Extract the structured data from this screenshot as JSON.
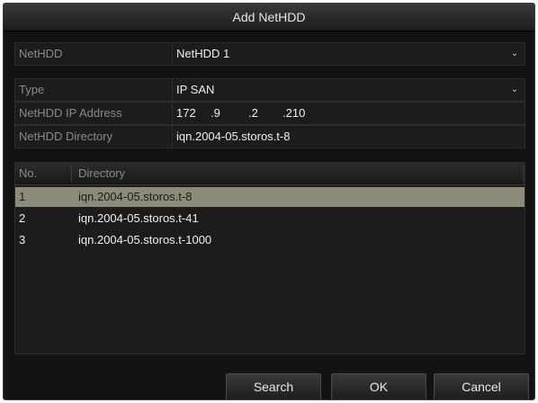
{
  "dialog": {
    "title": "Add NetHDD"
  },
  "form": {
    "nethdd": {
      "label": "NetHDD",
      "value": "NetHDD 1"
    },
    "type": {
      "label": "Type",
      "value": "IP SAN"
    },
    "ip": {
      "label": "NetHDD IP Address",
      "parts": [
        "172",
        ".9",
        ".2",
        ".210"
      ]
    },
    "directory": {
      "label": "NetHDD Directory",
      "value": "iqn.2004-05.storos.t-8"
    }
  },
  "table": {
    "columns": [
      "No.",
      "Directory"
    ],
    "rows": [
      {
        "no": "1",
        "directory": "iqn.2004-05.storos.t-8"
      },
      {
        "no": "2",
        "directory": "iqn.2004-05.storos.t-41"
      },
      {
        "no": "3",
        "directory": "iqn.2004-05.storos.t-1000"
      }
    ],
    "selected_index": 0
  },
  "buttons": {
    "search": "Search",
    "ok": "OK",
    "cancel": "Cancel"
  },
  "icons": {
    "dropdown": "chevron-down-icon"
  },
  "colors": {
    "selected_row": "#8e8a79",
    "background": "#121212"
  }
}
